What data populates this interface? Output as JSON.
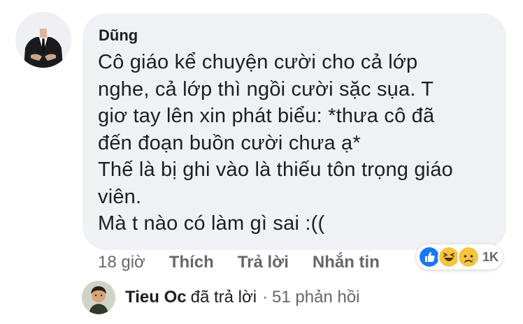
{
  "comment": {
    "author": "Dũng",
    "lines": [
      "Cô giáo kể chuyện cười cho cả lớp",
      "nghe, cả lớp thì ngồi cười sặc sụa. T",
      "giơ tay lên xin phát biểu: *thưa cô đã",
      "đến đoạn buồn cười chưa ạ*",
      "Thế là bị ghi vào là thiếu tôn trọng giáo",
      "viên.",
      "Mà t nào có làm gì sai :(("
    ],
    "time": "18 giờ",
    "actions": {
      "like": "Thích",
      "reply": "Trả lời",
      "message": "Nhắn tin"
    },
    "reactions": {
      "icons": [
        "like-icon",
        "haha-icon",
        "sad-icon"
      ],
      "count": "1K",
      "colors": {
        "like": "#1877f2",
        "emoji": "#f7c440"
      }
    }
  },
  "reply_preview": {
    "author": "Tieu Oc",
    "text": "đã trả lời",
    "separator": "·",
    "count": "51 phản hồi"
  }
}
